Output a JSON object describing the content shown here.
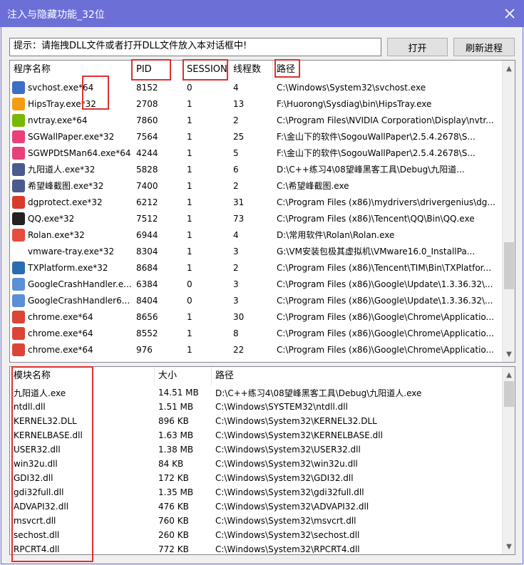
{
  "window": {
    "title": "注入与隐藏功能_32位"
  },
  "toolbar": {
    "hint_text": "提示：请拖拽DLL文件或者打开DLL文件放入本对话框中!",
    "open_label": "打开",
    "refresh_label": "刷新进程"
  },
  "process_list": {
    "columns": [
      "程序名称",
      "PID",
      "SESSION",
      "线程数",
      "路径"
    ],
    "rows": [
      {
        "name": "svchost.exe*64",
        "pid": "8152",
        "session": "0",
        "threads": "4",
        "path": "C:\\Windows\\System32\\svchost.exe",
        "icon": "svchost-icon",
        "color": "#3c6fc4"
      },
      {
        "name": "HipsTray.exe*32",
        "pid": "2708",
        "session": "1",
        "threads": "13",
        "path": "F:\\Huorong\\Sysdiag\\bin\\HipsTray.exe",
        "icon": "huorong-icon",
        "color": "#f39c12"
      },
      {
        "name": "nvtray.exe*64",
        "pid": "7860",
        "session": "1",
        "threads": "2",
        "path": "C:\\Program Files\\NVIDIA Corporation\\Display\\nvtr...",
        "icon": "nvidia-icon",
        "color": "#76b900"
      },
      {
        "name": "SGWallPaper.exe*32",
        "pid": "7564",
        "session": "1",
        "threads": "25",
        "path": "F:\\金山下的软件\\SogouWallPaper\\2.5.4.2678\\S...",
        "icon": "sogou-icon",
        "color": "#e8407a"
      },
      {
        "name": "SGWPDtSMan64.exe*64",
        "pid": "4244",
        "session": "1",
        "threads": "5",
        "path": "F:\\金山下的软件\\SogouWallPaper\\2.5.4.2678\\S...",
        "icon": "sogou-icon",
        "color": "#e8407a"
      },
      {
        "name": "九阳道人.exe*32",
        "pid": "5828",
        "session": "1",
        "threads": "6",
        "path": "D:\\C++练习4\\08望峰黑客工具\\Debug\\九阳道...",
        "icon": "avatar-icon",
        "color": "#4a5b8c"
      },
      {
        "name": "希望峰截图.exe*32",
        "pid": "7400",
        "session": "1",
        "threads": "2",
        "path": "C:\\希望峰截图.exe",
        "icon": "avatar-icon",
        "color": "#4a5b8c"
      },
      {
        "name": "dgprotect.exe*32",
        "pid": "6212",
        "session": "1",
        "threads": "31",
        "path": "C:\\Program Files (x86)\\mydrivers\\drivergenius\\dg...",
        "icon": "drivergenius-icon",
        "color": "#d83a2b"
      },
      {
        "name": "QQ.exe*32",
        "pid": "7512",
        "session": "1",
        "threads": "73",
        "path": "C:\\Program Files (x86)\\Tencent\\QQ\\Bin\\QQ.exe",
        "icon": "qq-icon",
        "color": "#222222"
      },
      {
        "name": "Rolan.exe*32",
        "pid": "6944",
        "session": "1",
        "threads": "4",
        "path": "D:\\常用软件\\Rolan\\Rolan.exe",
        "icon": "rolan-icon",
        "color": "#e74c3c"
      },
      {
        "name": "vmware-tray.exe*32",
        "pid": "8304",
        "session": "1",
        "threads": "3",
        "path": "G:\\VM安装包极其虚拟机\\VMware16.0_InstallPa...",
        "icon": "blank-icon",
        "color": "#ffffff"
      },
      {
        "name": "TXPlatform.exe*32",
        "pid": "8684",
        "session": "1",
        "threads": "2",
        "path": "C:\\Program Files (x86)\\Tencent\\TIM\\Bin\\TXPlatfor...",
        "icon": "window-icon",
        "color": "#2b6cb0"
      },
      {
        "name": "GoogleCrashHandler.e...",
        "pid": "6384",
        "session": "0",
        "threads": "3",
        "path": "C:\\Program Files (x86)\\Google\\Update\\1.3.36.32\\...",
        "icon": "google-update-icon",
        "color": "#5b8fd6"
      },
      {
        "name": "GoogleCrashHandler6...",
        "pid": "8404",
        "session": "0",
        "threads": "3",
        "path": "C:\\Program Files (x86)\\Google\\Update\\1.3.36.32\\...",
        "icon": "google-update-icon",
        "color": "#5b8fd6"
      },
      {
        "name": "chrome.exe*64",
        "pid": "8656",
        "session": "1",
        "threads": "30",
        "path": "C:\\Program Files (x86)\\Google\\Chrome\\Applicatio...",
        "icon": "chrome-icon",
        "color": "#db4437"
      },
      {
        "name": "chrome.exe*64",
        "pid": "8552",
        "session": "1",
        "threads": "8",
        "path": "C:\\Program Files (x86)\\Google\\Chrome\\Applicatio...",
        "icon": "chrome-icon",
        "color": "#db4437"
      },
      {
        "name": "chrome.exe*64",
        "pid": "976",
        "session": "1",
        "threads": "22",
        "path": "C:\\Program Files (x86)\\Google\\Chrome\\Applicatio...",
        "icon": "chrome-icon",
        "color": "#db4437"
      }
    ]
  },
  "module_list": {
    "columns": [
      "模块名称",
      "大小",
      "路径"
    ],
    "rows": [
      {
        "name": "九阳道人.exe",
        "size": "14.51 MB",
        "path": "D:\\C++练习4\\08望峰黑客工具\\Debug\\九阳道人.exe"
      },
      {
        "name": "ntdll.dll",
        "size": "1.51 MB",
        "path": "C:\\Windows\\SYSTEM32\\ntdll.dll"
      },
      {
        "name": "KERNEL32.DLL",
        "size": "896 KB",
        "path": "C:\\Windows\\System32\\KERNEL32.DLL"
      },
      {
        "name": "KERNELBASE.dll",
        "size": "1.63 MB",
        "path": "C:\\Windows\\System32\\KERNELBASE.dll"
      },
      {
        "name": "USER32.dll",
        "size": "1.38 MB",
        "path": "C:\\Windows\\System32\\USER32.dll"
      },
      {
        "name": "win32u.dll",
        "size": "84 KB",
        "path": "C:\\Windows\\System32\\win32u.dll"
      },
      {
        "name": "GDI32.dll",
        "size": "172 KB",
        "path": "C:\\Windows\\System32\\GDI32.dll"
      },
      {
        "name": "gdi32full.dll",
        "size": "1.35 MB",
        "path": "C:\\Windows\\System32\\gdi32full.dll"
      },
      {
        "name": "ADVAPI32.dll",
        "size": "476 KB",
        "path": "C:\\Windows\\System32\\ADVAPI32.dll"
      },
      {
        "name": "msvcrt.dll",
        "size": "760 KB",
        "path": "C:\\Windows\\System32\\msvcrt.dll"
      },
      {
        "name": "sechost.dll",
        "size": "260 KB",
        "path": "C:\\Windows\\System32\\sechost.dll"
      },
      {
        "name": "RPCRT4.dll",
        "size": "772 KB",
        "path": "C:\\Windows\\System32\\RPCRT4.dll"
      }
    ]
  },
  "scroll": {
    "process_position": 0.74,
    "module_position": 0.0
  },
  "colors": {
    "titlebar": "#6b6fd6",
    "highlight": "#e03030"
  }
}
